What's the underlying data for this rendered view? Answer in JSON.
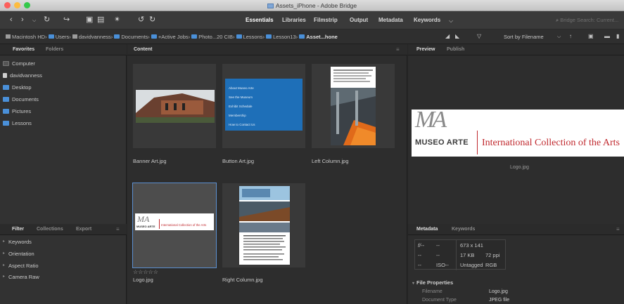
{
  "window": {
    "title": "Assets_iPhone - Adobe Bridge",
    "colors": {
      "close": "#fc605c",
      "minimize": "#fdbc40",
      "zoom": "#34c84a",
      "accent": "#4a90d9"
    }
  },
  "toolbar": {
    "workspaces": [
      "Essentials",
      "Libraries",
      "Filmstrip",
      "Output",
      "Metadata",
      "Keywords"
    ],
    "active_workspace": "Essentials",
    "search_placeholder": "Bridge Search: Current..."
  },
  "pathbar": {
    "crumbs": [
      "Macintosh HD",
      "Users",
      "davidvanness",
      "Documents",
      "+Active Jobs",
      "Photo...20 CIB",
      "Lessons",
      "Lesson13",
      "Asset...hone"
    ],
    "sort_label": "Sort by Filename"
  },
  "left_panel": {
    "tabs": [
      "Favorites",
      "Folders"
    ],
    "favorites": [
      "Computer",
      "davidvanness",
      "Desktop",
      "Documents",
      "Pictures",
      "Lessons"
    ],
    "filter_tabs": [
      "Filter",
      "Collections",
      "Export"
    ],
    "filter_items": [
      "Keywords",
      "Orientation",
      "Aspect Ratio",
      "Camera Raw"
    ]
  },
  "content": {
    "tab": "Content",
    "items": [
      {
        "filename": "Banner Art.jpg"
      },
      {
        "filename": "Button Art.jpg"
      },
      {
        "filename": "Left Column.jpg"
      },
      {
        "filename": "Logo.jpg",
        "stars": "☆☆☆☆☆"
      },
      {
        "filename": "Right Column.jpg"
      }
    ],
    "button_art_menu": [
      "About Museo Arte",
      "See the Museum",
      "Exhibit Schedule",
      "Membership",
      "How to Contact Us"
    ]
  },
  "preview": {
    "tabs": [
      "Preview",
      "Publish"
    ],
    "logo_monogram": "MA",
    "logo_name": "MUSEO ARTE",
    "logo_tagline": "International Collection of the Arts",
    "filename": "Logo.jpg"
  },
  "metadata": {
    "tabs": [
      "Metadata",
      "Keywords"
    ],
    "camera_rows": [
      {
        "left": "f/--",
        "mid": "--",
        "right": "673 x 141"
      },
      {
        "left": "--",
        "mid": "--",
        "right": "17 KB",
        "right2": "72 ppi"
      },
      {
        "left": "--",
        "mid": "ISO--",
        "right": "Untagged",
        "right2": "RGB"
      }
    ],
    "section": "File Properties",
    "properties": [
      {
        "label": "Filename",
        "value": "Logo.jpg"
      },
      {
        "label": "Document Type",
        "value": "JPEG file"
      }
    ]
  }
}
